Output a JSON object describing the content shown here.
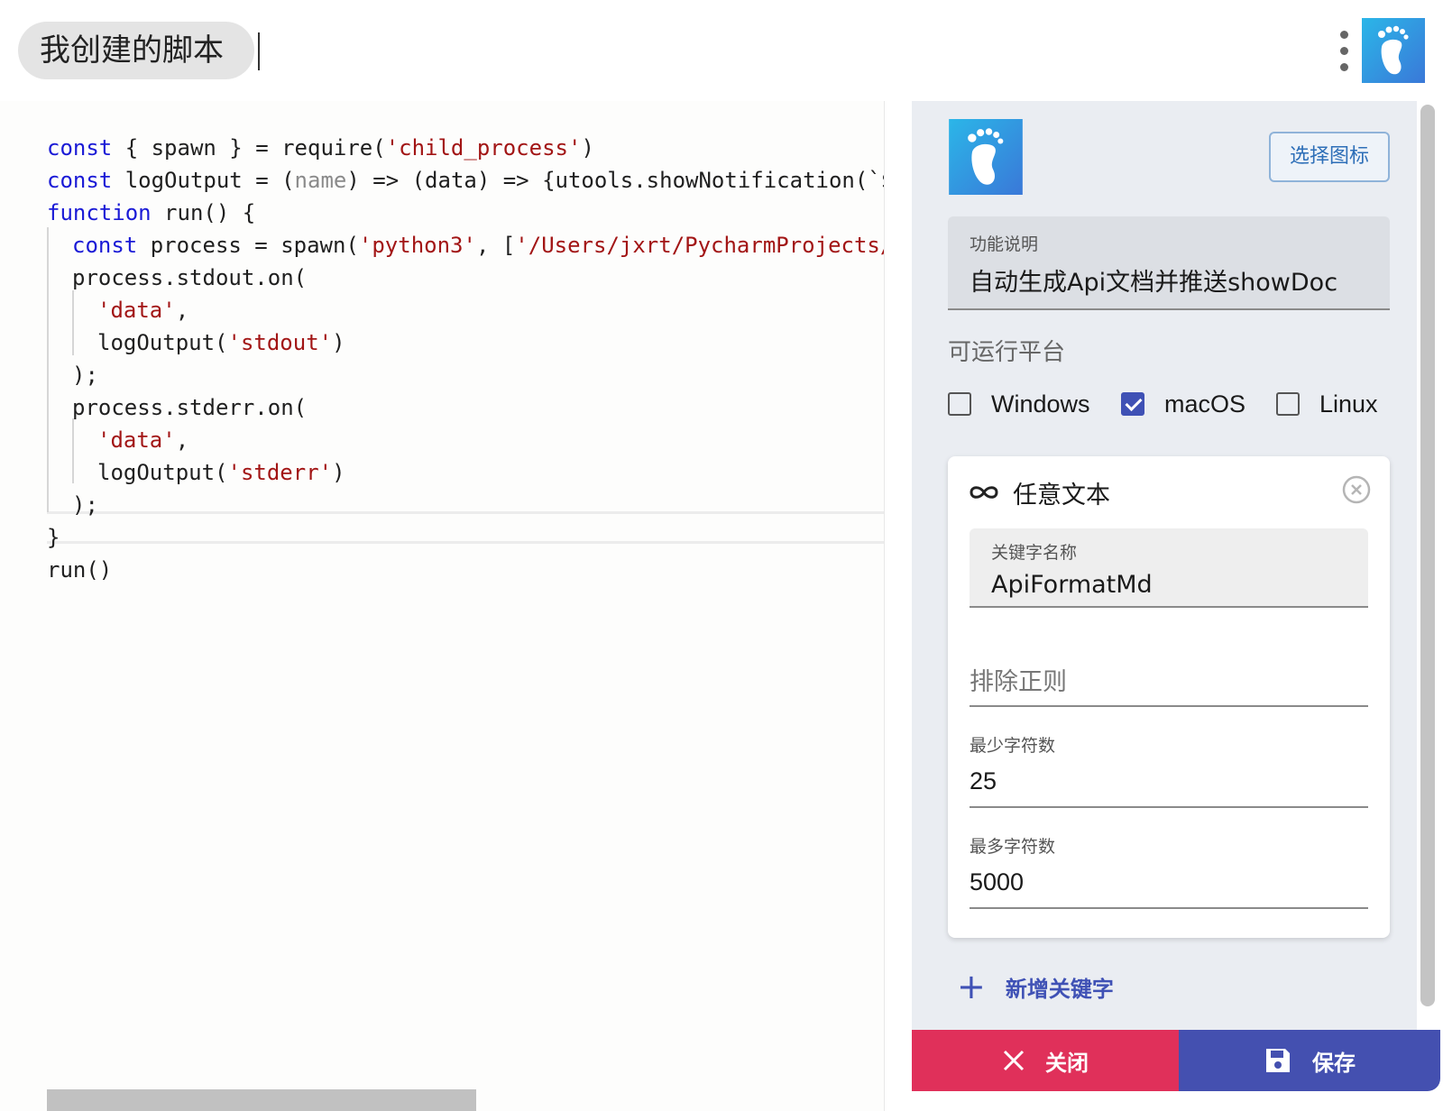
{
  "header": {
    "title": "我创建的脚本"
  },
  "editor": {
    "lines": [
      {
        "indent": 0,
        "parts": [
          [
            "kw",
            "const"
          ],
          [
            "p",
            " { spawn } = require("
          ],
          [
            "str",
            "'child_process'"
          ],
          [
            "p",
            ")"
          ]
        ]
      },
      {
        "indent": 0,
        "parts": [
          [
            "kw",
            "const"
          ],
          [
            "p",
            " logOutput = ("
          ],
          [
            "dim",
            "name"
          ],
          [
            "p",
            ") => (data) => {utools.showNotification(`${"
          ]
        ]
      },
      {
        "indent": 0,
        "parts": [
          [
            "kw",
            "function"
          ],
          [
            "p",
            " run() {"
          ]
        ]
      },
      {
        "indent": 1,
        "parts": [
          [
            "kw",
            "const"
          ],
          [
            "p",
            " process = spawn("
          ],
          [
            "str",
            "'python3'"
          ],
          [
            "p",
            ", ["
          ],
          [
            "str",
            "'/Users/jxrt/PycharmProjects/A"
          ]
        ]
      },
      {
        "indent": 1,
        "parts": [
          [
            "p",
            "process.stdout.on("
          ]
        ]
      },
      {
        "indent": 2,
        "parts": [
          [
            "str",
            "'data'"
          ],
          [
            "p",
            ","
          ]
        ]
      },
      {
        "indent": 2,
        "parts": [
          [
            "p",
            "logOutput("
          ],
          [
            "str",
            "'stdout'"
          ],
          [
            "p",
            ")"
          ]
        ]
      },
      {
        "indent": 1,
        "parts": [
          [
            "p",
            ");"
          ]
        ]
      },
      {
        "indent": 1,
        "parts": [
          [
            "p",
            "process.stderr.on("
          ]
        ]
      },
      {
        "indent": 2,
        "parts": [
          [
            "str",
            "'data'"
          ],
          [
            "p",
            ","
          ]
        ]
      },
      {
        "indent": 2,
        "parts": [
          [
            "p",
            "logOutput("
          ],
          [
            "str",
            "'stderr'"
          ],
          [
            "p",
            ")"
          ]
        ]
      },
      {
        "indent": 1,
        "parts": [
          [
            "p",
            ");"
          ]
        ]
      },
      {
        "indent": 0,
        "parts": [
          [
            "p",
            "}"
          ]
        ]
      },
      {
        "indent": 0,
        "parts": [
          [
            "p",
            "run()"
          ]
        ]
      }
    ]
  },
  "panel": {
    "choose_icon_label": "选择图标",
    "description": {
      "label": "功能说明",
      "value": "自动生成Api文档并推送showDoc"
    },
    "platforms": {
      "title": "可运行平台",
      "items": [
        {
          "label": "Windows",
          "checked": false
        },
        {
          "label": "macOS",
          "checked": true
        },
        {
          "label": "Linux",
          "checked": false
        }
      ]
    },
    "keyword_card": {
      "title": "任意文本",
      "name_field": {
        "label": "关键字名称",
        "value": "ApiFormatMd"
      },
      "exclude_regex": {
        "placeholder": "排除正则"
      },
      "min_chars": {
        "label": "最少字符数",
        "value": "25"
      },
      "max_chars": {
        "label": "最多字符数",
        "value": "5000"
      }
    },
    "add_keyword_label": "新增关键字",
    "close_label": "关闭",
    "save_label": "保存"
  },
  "colors": {
    "accent": "#3f51b5",
    "close": "#e0305a",
    "save": "#4450b0",
    "keyword": "#1a1ad6",
    "string": "#a21515"
  }
}
